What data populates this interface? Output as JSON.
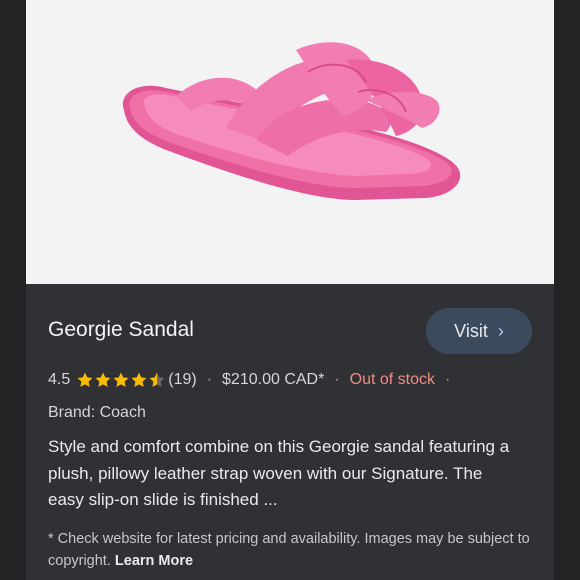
{
  "product": {
    "title": "Georgie Sandal",
    "visit_label": "Visit",
    "rating": "4.5",
    "rating_value": 4.5,
    "rating_max": 5,
    "review_count": "(19)",
    "price": "$210.00 CAD*",
    "stock_status": "Out of stock",
    "brand": "Brand: Coach",
    "description": "Style and comfort combine on this Georgie sandal featuring a plush, pillowy leather strap woven with our Signature. The easy slip-on slide is finished ...",
    "disclaimer": "* Check website for latest pricing and availability. Images may be subject to copyright.",
    "learn_more": "Learn More"
  },
  "colors": {
    "card_bg": "#303134",
    "star": "#fbbc04",
    "out_of_stock": "#f28b82",
    "visit_button": "#3c4a5e",
    "sandal": "#ee5fa0"
  },
  "icons": {
    "visit": "chevron-right-icon",
    "rating": "star-icon"
  }
}
